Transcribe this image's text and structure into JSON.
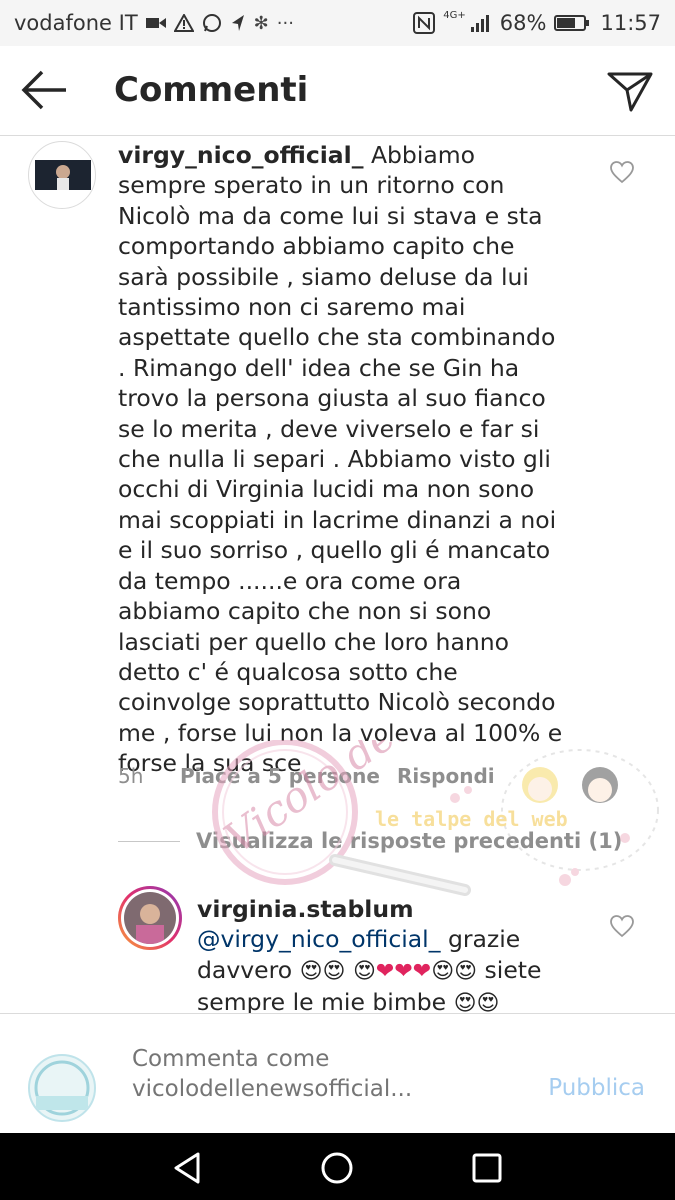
{
  "status_bar": {
    "carrier": "vodafone IT",
    "battery_percent": "68%",
    "battery_level": 0.68,
    "time": "11:57",
    "network": "4G+",
    "icons": [
      "video-icon",
      "warning-icon",
      "whatsapp-icon",
      "navigation-icon",
      "pinwheel-icon",
      "more-icon",
      "nfc-icon",
      "signal-icon",
      "battery-icon"
    ]
  },
  "header": {
    "title": "Commenti",
    "back_icon": "arrow-left-icon",
    "send_icon": "paper-plane-icon"
  },
  "comments": [
    {
      "username": "virgy_nico_official_",
      "text": " Abbiamo sempre sperato in un ritorno con Nicolò ma da come lui si stava e sta comportando abbiamo capito che sarà possibile , siamo deluse da lui tantissimo non ci saremo mai aspettate quello che sta combinando . Rimango dell' idea che se Gin ha trovo la persona giusta al suo fianco se lo merita , deve viverselo e far si che nulla li separi . Abbiamo visto gli occhi di Virginia  lucidi ma non sono mai scoppiati in lacrime dinanzi a noi e il suo sorriso , quello gli é mancato da tempo ......e ora come ora abbiamo capito che non si sono lasciati per quello che loro hanno detto c' é qualcosa sotto che coinvolge soprattutto Nicolò secondo me , forse lui non la voleva al 100% e forse la sua sce",
      "time": "5h",
      "likes": "Piace a 5 persone",
      "reply": "Rispondi"
    }
  ],
  "view_replies": "Visualizza le risposte precedenti (1)",
  "reply": {
    "username": "virginia.stablum",
    "mention": "@virgy_nico_official_",
    "text_1": " grazie davvero ",
    "text_2": " siete sempre le mie bimbe ",
    "emoji_heart_eyes": "😍",
    "emoji_red_heart": "❤"
  },
  "compose": {
    "placeholder": "Commenta come vicolodellenewsofficial...",
    "publish_label": "Pubblica"
  },
  "watermark": {
    "logo_text": "Vicolo delle News",
    "sticker_text": "le talpe del web"
  },
  "colors": {
    "accent_disabled": "#a6cdf0",
    "secondary_text": "#8e8e8e",
    "status_bar_bg": "#f5f5f5"
  }
}
